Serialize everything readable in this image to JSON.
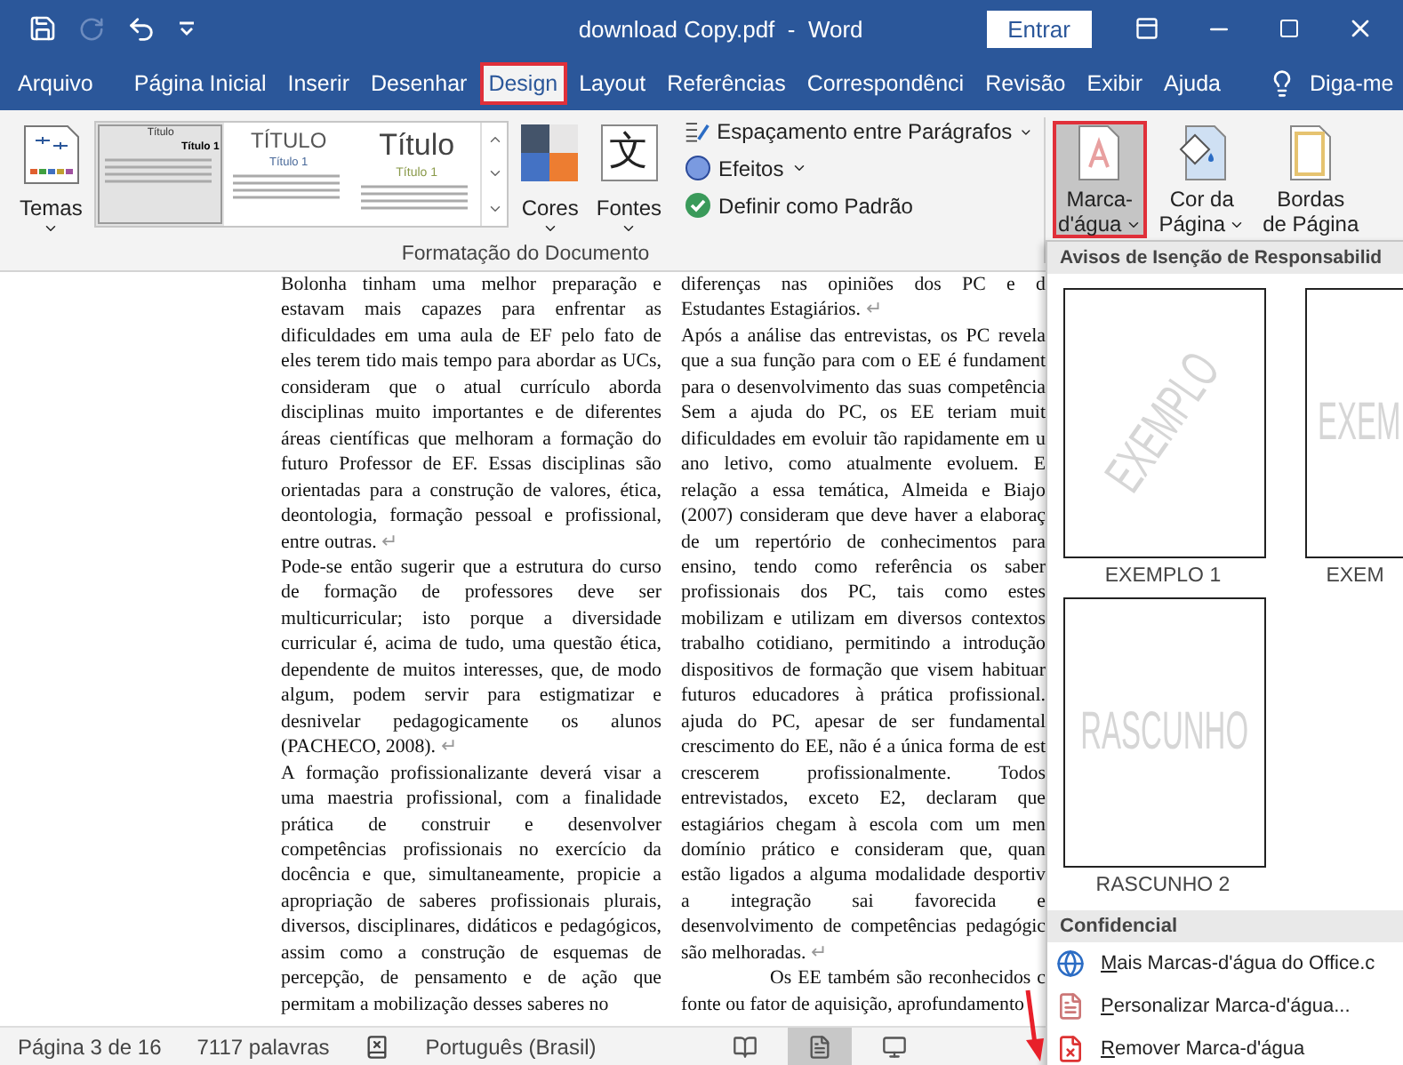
{
  "title_bar": {
    "title": "download Copy.pdf  -  Word",
    "sign_in": "Entrar",
    "quick_access": [
      {
        "kind": "save",
        "disabled": false
      },
      {
        "kind": "redo",
        "disabled": true
      },
      {
        "kind": "undo",
        "disabled": false
      },
      {
        "kind": "customize",
        "disabled": false
      }
    ]
  },
  "tabs": [
    {
      "label": "Arquivo",
      "selected": false,
      "highlighted": false
    },
    {
      "label": "Página Inicial",
      "selected": false,
      "highlighted": false
    },
    {
      "label": "Inserir",
      "selected": false,
      "highlighted": false
    },
    {
      "label": "Desenhar",
      "selected": false,
      "highlighted": false
    },
    {
      "label": "Design",
      "selected": true,
      "highlighted": true
    },
    {
      "label": "Layout",
      "selected": false,
      "highlighted": false
    },
    {
      "label": "Referências",
      "selected": false,
      "highlighted": false
    },
    {
      "label": "Correspondênci",
      "selected": false,
      "highlighted": false
    },
    {
      "label": "Revisão",
      "selected": false,
      "highlighted": false
    },
    {
      "label": "Exibir",
      "selected": false,
      "highlighted": false
    },
    {
      "label": "Ajuda",
      "selected": false,
      "highlighted": false
    }
  ],
  "tell_me": "Diga-me",
  "ribbon": {
    "themes": "Temas",
    "style_gallery": [
      {
        "kind": "basic",
        "title": "Título",
        "heading": "Título 1",
        "selected": true
      },
      {
        "kind": "caps",
        "title": "TÍTULO",
        "heading": "Título 1",
        "selected": false
      },
      {
        "kind": "large",
        "title": "Título",
        "heading": "Título 1",
        "selected": false
      }
    ],
    "colors": "Cores",
    "fonts": "Fontes",
    "fonts_glyph": "文",
    "options": [
      {
        "kind": "spacing",
        "label": "Espaçamento entre Parágrafos",
        "dropdown": true
      },
      {
        "kind": "effects",
        "label": "Efeitos",
        "dropdown": true
      },
      {
        "kind": "default",
        "label": "Definir como Padrão",
        "dropdown": false
      }
    ],
    "group_label": "Formatação do Documento",
    "page_background": [
      {
        "kind": "watermark",
        "lines": [
          "Marca-",
          "d'água"
        ],
        "dropdown": true,
        "selected": true,
        "highlighted": true
      },
      {
        "kind": "page_color",
        "lines": [
          "Cor da",
          "Página"
        ],
        "dropdown": true,
        "selected": false,
        "highlighted": false
      },
      {
        "kind": "page_borders",
        "lines": [
          "Bordas",
          "de Página"
        ],
        "dropdown": false,
        "selected": false,
        "highlighted": false
      }
    ]
  },
  "document": {
    "columns": [
      {
        "paragraphs": [
          {
            "indented": false,
            "mark": "↵",
            "lines": [
              "Bolonha tinham uma melhor preparação e",
              "estavam mais capazes para enfrentar as",
              "dificuldades em uma aula de EF pelo fato de",
              "eles terem tido mais tempo para abordar as UCs,",
              "consideram que o atual currículo aborda",
              "disciplinas muito importantes e de diferentes",
              "áreas científicas que melhoram a formação do",
              "futuro Professor de EF. Essas disciplinas são",
              "orientadas para a construção de valores, ética,",
              "deontologia, formação pessoal e profissional,",
              "entre outras."
            ]
          },
          {
            "indented": false,
            "mark": "↵",
            "lines": [
              "Pode-se então sugerir que a estrutura do curso",
              "de formação de professores deve ser",
              "multicurricular; isto porque a diversidade",
              "curricular é, acima de tudo, uma questão ética,",
              "dependente de muitos interesses, que, de modo",
              "algum, podem servir para estigmatizar e",
              "desnivelar pedagogicamente os alunos",
              "(PACHECO, 2008)."
            ]
          },
          {
            "indented": false,
            "lines": [
              "A formação profissionalizante deverá visar a",
              "uma maestria profissional, com a finalidade",
              "prática de construir e desenvolver",
              "competências profissionais no exercício da",
              "docência e que, simultaneamente, propicie a",
              "apropriação de saberes profissionais plurais,",
              "diversos, disciplinares, didáticos e pedagógicos,",
              "assim como a construção de esquemas de",
              "percepção, de pensamento e de ação que",
              "permitam a mobilização desses saberes no"
            ]
          }
        ]
      },
      {
        "paragraphs": [
          {
            "indented": false,
            "mark": "↵",
            "lines": [
              "diferenças nas opiniões dos PC e d",
              "Estudantes Estagiários."
            ]
          },
          {
            "indented": false,
            "mark": "↵",
            "lines": [
              "Após a análise das entrevistas, os PC revela",
              "que a sua função para com o EE é fundament",
              "para o desenvolvimento das suas competência",
              "Sem a ajuda do PC, os EE teriam muit",
              "dificuldades em evoluir tão rapidamente em u",
              "ano letivo, como atualmente evoluem. E",
              "relação a essa temática, Almeida e Biajo",
              "(2007) consideram que deve haver a elaboraç",
              "de um repertório de conhecimentos para",
              "ensino, tendo como referência os saber",
              "profissionais dos PC, tais como estes",
              "mobilizam e utilizam em diversos contextos",
              "trabalho cotidiano, permitindo a introdução",
              "dispositivos de formação que visem habituar",
              "futuros educadores à prática profissional.",
              "ajuda do PC, apesar de ser fundamental",
              "crescimento do EE, não é a única forma de est",
              "crescerem profissionalmente. Todos",
              "entrevistados, exceto E2, declaram que",
              "estagiários chegam à escola com um men",
              "domínio prático e consideram que, quan",
              "estão ligados a alguma modalidade desportiv",
              "a integração sai favorecida e",
              "desenvolvimento de competências pedagógic",
              "são melhoradas."
            ]
          },
          {
            "indented": true,
            "lines": [
              "Os EE também são reconhecidos c",
              "fonte ou fator de aquisição, aprofundamento"
            ]
          }
        ]
      }
    ]
  },
  "watermark_menu": {
    "header": "Avisos de Isenção de Responsabilid",
    "samples": [
      {
        "kind": "diagonal",
        "sample": "EXEMPLO",
        "label": "EXEMPLO 1"
      },
      {
        "kind": "horizontal",
        "sample": "EXEM",
        "label": "EXEM"
      },
      {
        "kind": "horizontal",
        "sample": "RASCUNHO",
        "label": "RASCUNHO 2"
      }
    ],
    "section": "Confidencial",
    "items": [
      {
        "kind": "online",
        "label": "Mais Marcas-d'água do Office.c"
      },
      {
        "kind": "custom",
        "label": "Personalizar Marca-d'água..."
      },
      {
        "kind": "remove",
        "label": "Remover Marca-d'água"
      }
    ]
  },
  "status_bar": {
    "page": "Página 3 de 16",
    "words": "7117 palavras",
    "language": "Português (Brasil)",
    "views": [
      {
        "kind": "read",
        "selected": false
      },
      {
        "kind": "print",
        "selected": true
      },
      {
        "kind": "web",
        "selected": false
      }
    ]
  }
}
